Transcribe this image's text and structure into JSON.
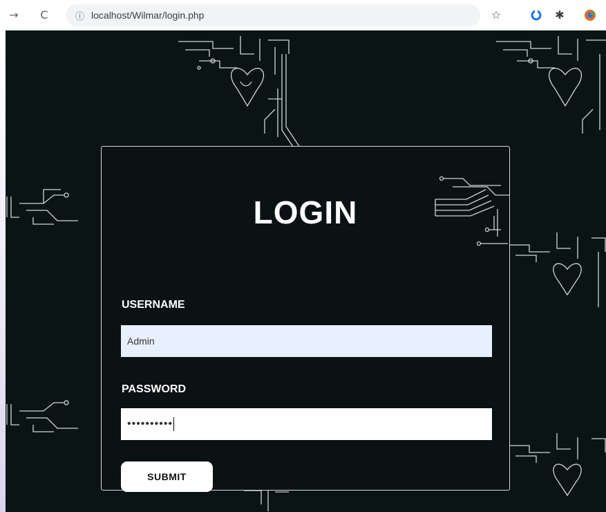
{
  "browser": {
    "back_glyph": "→",
    "reload_glyph": "C",
    "info_glyph": "ⓘ",
    "url": "localhost/Wilmar/login.php",
    "icons": [
      "back-arrow-icon",
      "reload-icon",
      "site-info-icon",
      "bookmark-star-icon",
      "extension-icon",
      "puzzle-icon",
      "profile-icon"
    ]
  },
  "login": {
    "title": "LOGIN",
    "username_label": "USERNAME",
    "username_value": "Admin",
    "password_label": "PASSWORD",
    "password_value": "••••••••••",
    "submit_label": "SUBMIT"
  },
  "colors": {
    "page_bg": "#0b1415",
    "circuit_line": "#cfd6d8",
    "autofill_bg": "#e8f0fe"
  }
}
